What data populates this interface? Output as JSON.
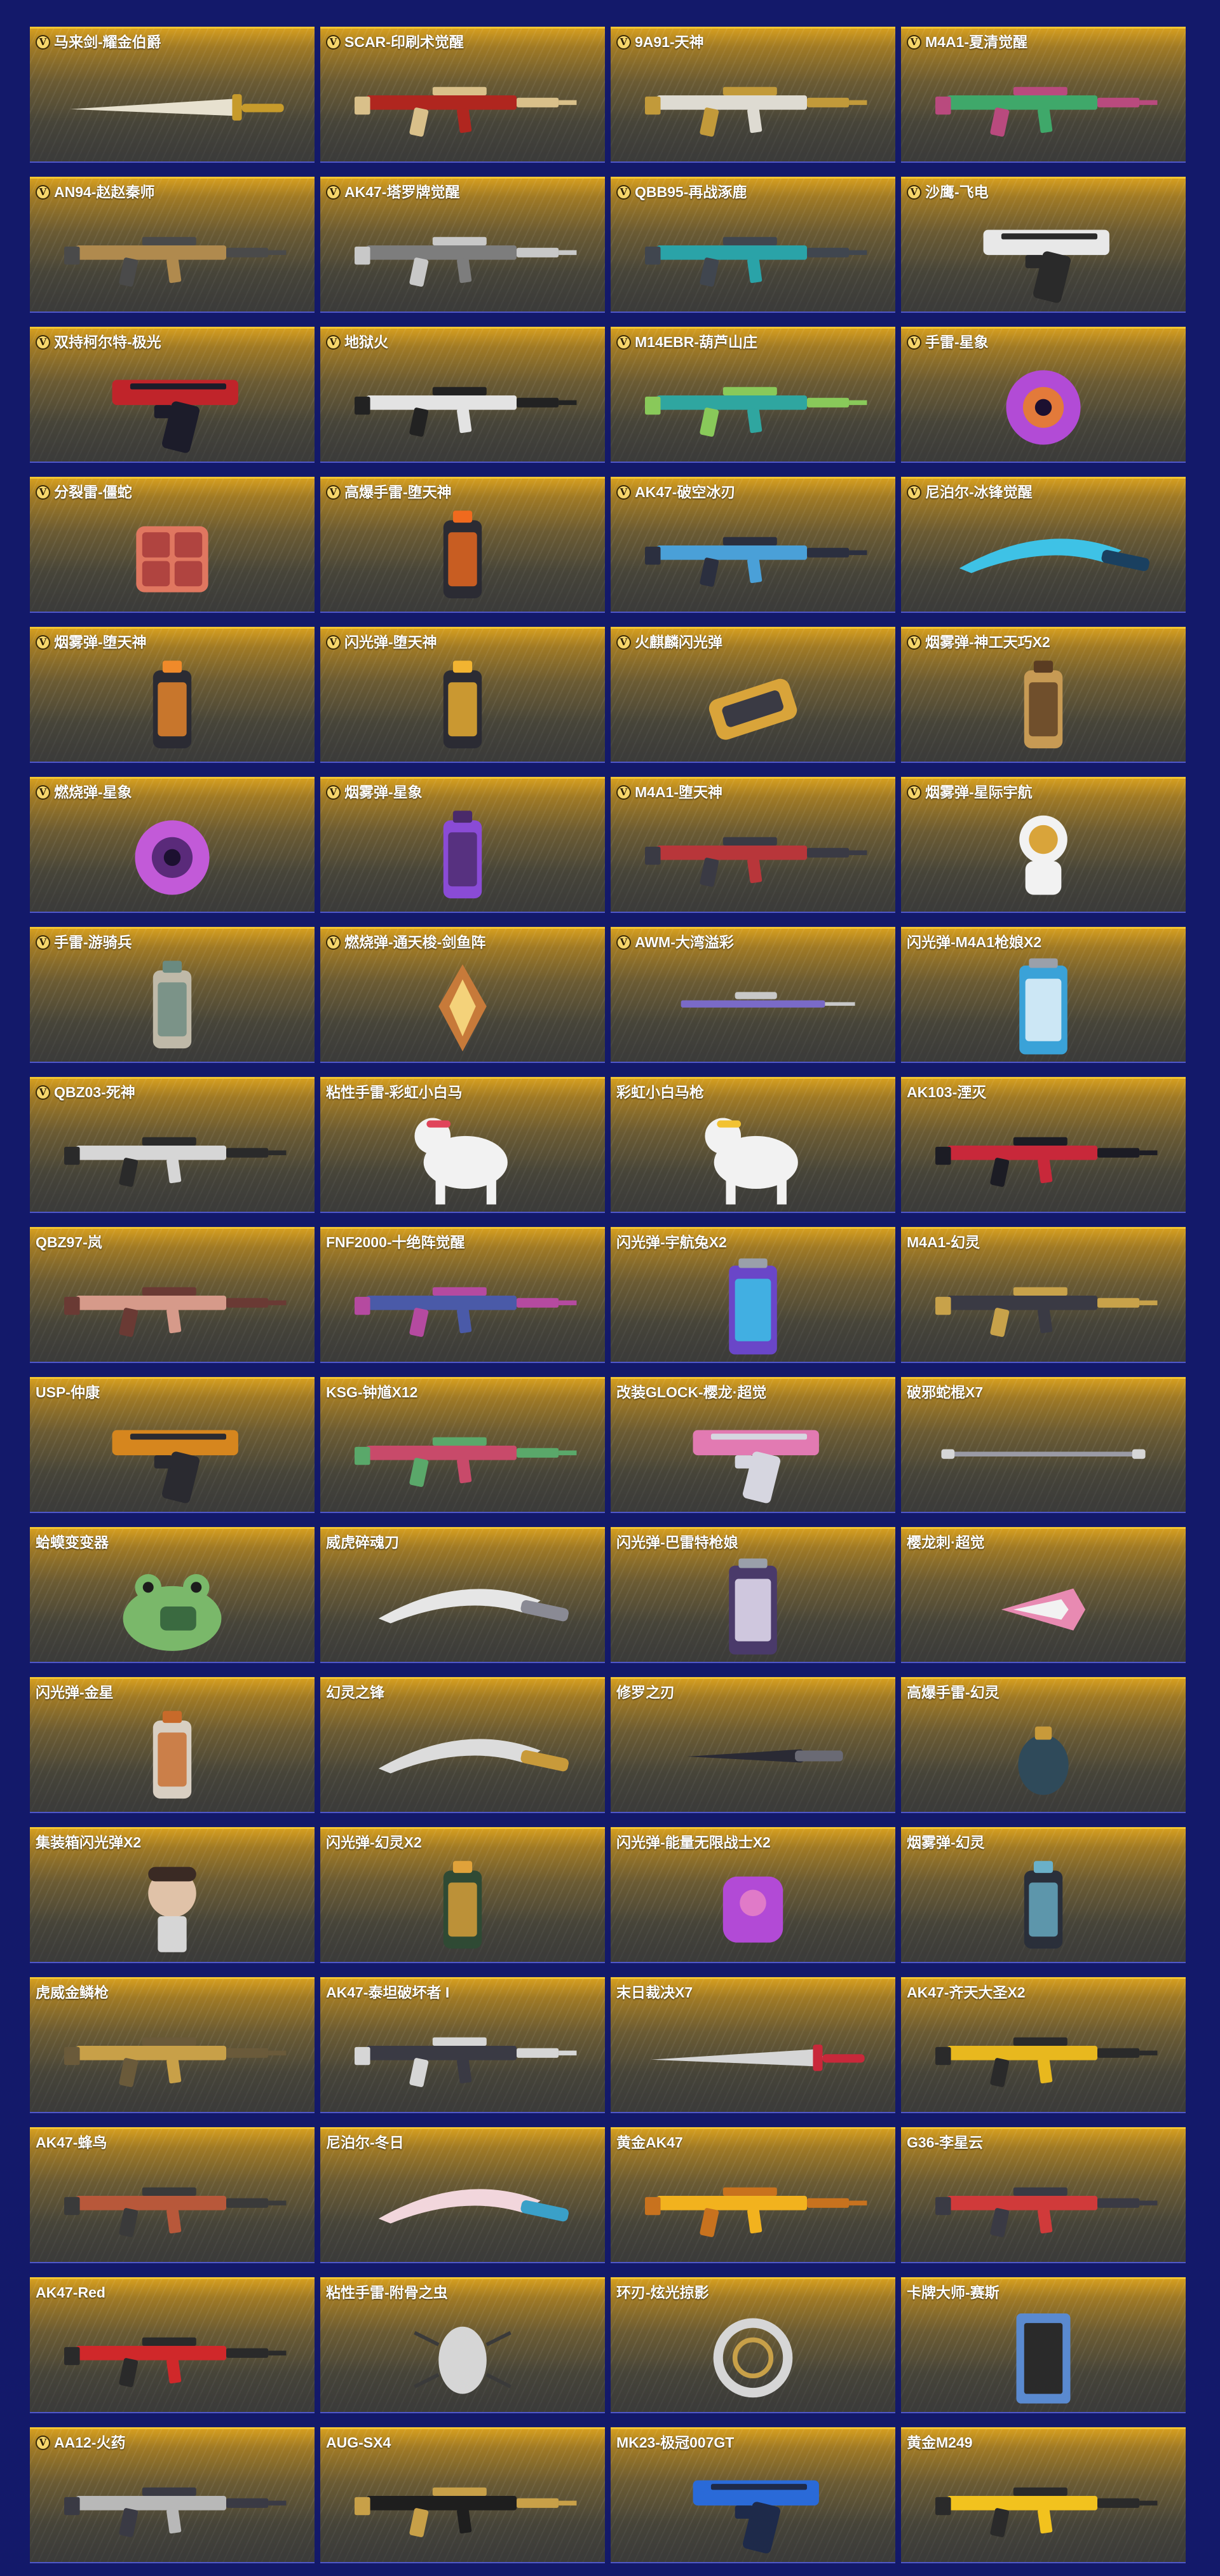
{
  "items": [
    {
      "name": "马来剑-耀金伯爵",
      "v": true,
      "icon": "sword-icon",
      "c1": "#e7e1cf",
      "c2": "#c79b2b"
    },
    {
      "name": "SCAR-印刷术觉醒",
      "v": true,
      "icon": "rifle-icon",
      "c1": "#b0261f",
      "c2": "#d9c08a"
    },
    {
      "name": "9A91-天神",
      "v": true,
      "icon": "rifle-icon",
      "c1": "#dedbd2",
      "c2": "#c29a3a"
    },
    {
      "name": "M4A1-夏清觉醒",
      "v": true,
      "icon": "rifle-icon",
      "c1": "#3fa86a",
      "c2": "#b94a7e"
    },
    {
      "name": "AN94-赵赵秦师",
      "v": true,
      "icon": "rifle-icon",
      "c1": "#b08a4e",
      "c2": "#4a4a4a"
    },
    {
      "name": "AK47-塔罗牌觉醒",
      "v": true,
      "icon": "rifle-icon",
      "c1": "#7d7d7d",
      "c2": "#c8c8c8"
    },
    {
      "name": "QBB95-再战涿鹿",
      "v": true,
      "icon": "rifle-icon",
      "c1": "#2aa3a8",
      "c2": "#40464f"
    },
    {
      "name": "沙鹰-飞电",
      "v": true,
      "icon": "pistol-icon",
      "c1": "#e8e8e8",
      "c2": "#2a2a2a"
    },
    {
      "name": "双持柯尔特-极光",
      "v": true,
      "icon": "pistol-icon",
      "c1": "#c0242a",
      "c2": "#1c1c2a"
    },
    {
      "name": "地狱火",
      "v": true,
      "icon": "rifle-icon",
      "c1": "#e3e3e3",
      "c2": "#222222"
    },
    {
      "name": "M14EBR-葫芦山庄",
      "v": true,
      "icon": "rifle-icon",
      "c1": "#2fa6a0",
      "c2": "#89c95a"
    },
    {
      "name": "手雷-星象",
      "v": true,
      "icon": "orb-icon",
      "c1": "#b24bd6",
      "c2": "#e37a3a"
    },
    {
      "name": "分裂雷-僵蛇",
      "v": true,
      "icon": "cube-icon",
      "c1": "#e07760",
      "c2": "#b04440"
    },
    {
      "name": "高爆手雷-堕天神",
      "v": true,
      "icon": "canister-icon",
      "c1": "#2b2b33",
      "c2": "#f06a1e"
    },
    {
      "name": "AK47-破空冰刃",
      "v": true,
      "icon": "rifle-icon",
      "c1": "#4aa0d8",
      "c2": "#2b2f3f"
    },
    {
      "name": "尼泊尔-冰锋觉醒",
      "v": true,
      "icon": "blade-icon",
      "c1": "#3ec2e6",
      "c2": "#1a4060"
    },
    {
      "name": "烟雾弹-堕天神",
      "v": true,
      "icon": "canister-icon",
      "c1": "#2b2b33",
      "c2": "#f08a2a"
    },
    {
      "name": "闪光弹-堕天神",
      "v": true,
      "icon": "canister-icon",
      "c1": "#2b2b33",
      "c2": "#f2b431"
    },
    {
      "name": "火麒麟闪光弹",
      "v": true,
      "icon": "launcher-icon",
      "c1": "#d9a43a",
      "c2": "#3a3a44"
    },
    {
      "name": "烟雾弹-神工天巧X2",
      "v": true,
      "icon": "canister-icon",
      "c1": "#c79a54",
      "c2": "#5a3c22"
    },
    {
      "name": "燃烧弹-星象",
      "v": true,
      "icon": "orb-icon",
      "c1": "#c25ad8",
      "c2": "#5a2a7a"
    },
    {
      "name": "烟雾弹-星象",
      "v": true,
      "icon": "canister-icon",
      "c1": "#8a4bd6",
      "c2": "#4a2a6a"
    },
    {
      "name": "M4A1-堕天神",
      "v": true,
      "icon": "rifle-icon",
      "c1": "#b8363a",
      "c2": "#3a3a44"
    },
    {
      "name": "烟雾弹-星际宇航",
      "v": true,
      "icon": "astronaut-icon",
      "c1": "#f2f2f2",
      "c2": "#d9a43a"
    },
    {
      "name": "手雷-游骑兵",
      "v": true,
      "icon": "canister-icon",
      "c1": "#bfb9a8",
      "c2": "#6a8a80"
    },
    {
      "name": "燃烧弹-通天梭-剑鱼阵",
      "v": true,
      "icon": "crystal-icon",
      "c1": "#c77a3a",
      "c2": "#f4d27a"
    },
    {
      "name": "AWM-大湾溢彩",
      "v": true,
      "icon": "sniper-icon",
      "c1": "#7a6ac8",
      "c2": "#c8c8c8"
    },
    {
      "name": "闪光弹-M4A1枪娘X2",
      "v": false,
      "icon": "can-icon",
      "c1": "#3aa2d8",
      "c2": "#e6f3fa"
    },
    {
      "name": "QBZ03-死神",
      "v": true,
      "icon": "rifle-icon",
      "c1": "#d6d6d6",
      "c2": "#2a2a2a"
    },
    {
      "name": "粘性手雷-彩虹小白马",
      "v": false,
      "icon": "pony-icon",
      "c1": "#f2f2f2",
      "c2": "#e0445a"
    },
    {
      "name": "彩虹小白马枪",
      "v": false,
      "icon": "pony-icon",
      "c1": "#f2f2f2",
      "c2": "#f2c232"
    },
    {
      "name": "AK103-湮灭",
      "v": false,
      "icon": "rifle-icon",
      "c1": "#c8283a",
      "c2": "#1c1c24"
    },
    {
      "name": "QBZ97-岚",
      "v": false,
      "icon": "rifle-icon",
      "c1": "#d69a8a",
      "c2": "#6a3a34"
    },
    {
      "name": "FNF2000-十绝阵觉醒",
      "v": false,
      "icon": "rifle-icon",
      "c1": "#4a5aa8",
      "c2": "#b54aa0"
    },
    {
      "name": "闪光弹-宇航兔X2",
      "v": false,
      "icon": "can-icon",
      "c1": "#6a46c8",
      "c2": "#3ac2e6"
    },
    {
      "name": "M4A1-幻灵",
      "v": false,
      "icon": "rifle-icon",
      "c1": "#3a3a44",
      "c2": "#c8a24a"
    },
    {
      "name": "USP-仲康",
      "v": false,
      "icon": "pistol-icon",
      "c1": "#d6861e",
      "c2": "#2a2a30"
    },
    {
      "name": "KSG-钟馗X12",
      "v": false,
      "icon": "rifle-icon",
      "c1": "#c84a6a",
      "c2": "#5aa86a"
    },
    {
      "name": "改装GLOCK-樱龙·超觉",
      "v": false,
      "icon": "pistol-icon",
      "c1": "#e27ab2",
      "c2": "#d6d6e0"
    },
    {
      "name": "破邪蛇棍X7",
      "v": false,
      "icon": "staff-icon",
      "c1": "#9a9aa4",
      "c2": "#d6d6d6"
    },
    {
      "name": "蛤蟆变变器",
      "v": false,
      "icon": "frog-icon",
      "c1": "#7ab86a",
      "c2": "#3a6a40"
    },
    {
      "name": "威虎碎魂刀",
      "v": false,
      "icon": "blade-icon",
      "c1": "#e6e6e6",
      "c2": "#8a8a94"
    },
    {
      "name": "闪光弹-巴雷特枪娘",
      "v": false,
      "icon": "can-icon",
      "c1": "#4a3a6a",
      "c2": "#e6e0f2"
    },
    {
      "name": "樱龙刺·超觉",
      "v": false,
      "icon": "claw-icon",
      "c1": "#e88ab2",
      "c2": "#f2f2f2"
    },
    {
      "name": "闪光弹-金星",
      "v": false,
      "icon": "canister-icon",
      "c1": "#d8cfc2",
      "c2": "#c86a2a"
    },
    {
      "name": "幻灵之锋",
      "v": false,
      "icon": "blade-icon",
      "c1": "#dcdcdc",
      "c2": "#c89a3a"
    },
    {
      "name": "修罗之刃",
      "v": false,
      "icon": "knife-icon",
      "c1": "#2a2a34",
      "c2": "#6a6a74"
    },
    {
      "name": "高爆手雷-幻灵",
      "v": false,
      "icon": "grenade-icon",
      "c1": "#2f4a5a",
      "c2": "#c89a3a"
    },
    {
      "name": "集装箱闪光弹X2",
      "v": false,
      "icon": "doll-icon",
      "c1": "#e0c2a8",
      "c2": "#3a2a24"
    },
    {
      "name": "闪光弹-幻灵X2",
      "v": false,
      "icon": "canister-icon",
      "c1": "#2f4a34",
      "c2": "#e0a23a"
    },
    {
      "name": "闪光弹-能量无限战士X2",
      "v": false,
      "icon": "robot-icon",
      "c1": "#b24ad6",
      "c2": "#e07ac8"
    },
    {
      "name": "烟雾弹-幻灵",
      "v": false,
      "icon": "canister-icon",
      "c1": "#2a2f3a",
      "c2": "#6ab0c8"
    },
    {
      "name": "虎威金鳞枪",
      "v": false,
      "icon": "rifle-icon",
      "c1": "#c8a048",
      "c2": "#6a5a3a"
    },
    {
      "name": "AK47-泰坦破坏者 I",
      "v": false,
      "icon": "rifle-icon",
      "c1": "#3a3a44",
      "c2": "#d6d6d6"
    },
    {
      "name": "末日裁决X7",
      "v": false,
      "icon": "sword-icon",
      "c1": "#d6d6d6",
      "c2": "#c8283a"
    },
    {
      "name": "AK47-齐天大圣X2",
      "v": false,
      "icon": "rifle-icon",
      "c1": "#e8b81e",
      "c2": "#2a2a2a"
    },
    {
      "name": "AK47-蜂鸟",
      "v": false,
      "icon": "rifle-icon",
      "c1": "#b8583a",
      "c2": "#3a3a3a"
    },
    {
      "name": "尼泊尔-冬日",
      "v": false,
      "icon": "blade-icon",
      "c1": "#f2d6dc",
      "c2": "#3aa0c8"
    },
    {
      "name": "黄金AK47",
      "v": false,
      "icon": "rifle-icon",
      "c1": "#f2b21e",
      "c2": "#c8721e"
    },
    {
      "name": "G36-李星云",
      "v": false,
      "icon": "rifle-icon",
      "c1": "#d03a3a",
      "c2": "#3a3a44"
    },
    {
      "name": "AK47-Red",
      "v": false,
      "icon": "rifle-icon",
      "c1": "#d0282a",
      "c2": "#2a2a2a"
    },
    {
      "name": "粘性手雷-附骨之虫",
      "v": false,
      "icon": "bug-icon",
      "c1": "#d6d6d6",
      "c2": "#3a3a3a"
    },
    {
      "name": "环刃-炫光掠影",
      "v": false,
      "icon": "ring-icon",
      "c1": "#d6d6d6",
      "c2": "#c8a048"
    },
    {
      "name": "卡牌大师-赛斯",
      "v": false,
      "icon": "card-icon",
      "c1": "#5a8ad0",
      "c2": "#2a2a2a"
    },
    {
      "name": "AA12-火药",
      "v": true,
      "icon": "rifle-icon",
      "c1": "#b8b8b8",
      "c2": "#3a3a44"
    },
    {
      "name": "AUG-SX4",
      "v": false,
      "icon": "rifle-icon",
      "c1": "#1e1e1e",
      "c2": "#c8a048"
    },
    {
      "name": "MK23-极冠007GT",
      "v": false,
      "icon": "pistol-icon",
      "c1": "#2a6ad8",
      "c2": "#1e2a4a"
    },
    {
      "name": "黄金M249",
      "v": false,
      "icon": "rifle-icon",
      "c1": "#f2c21e",
      "c2": "#2a2a2a"
    }
  ]
}
